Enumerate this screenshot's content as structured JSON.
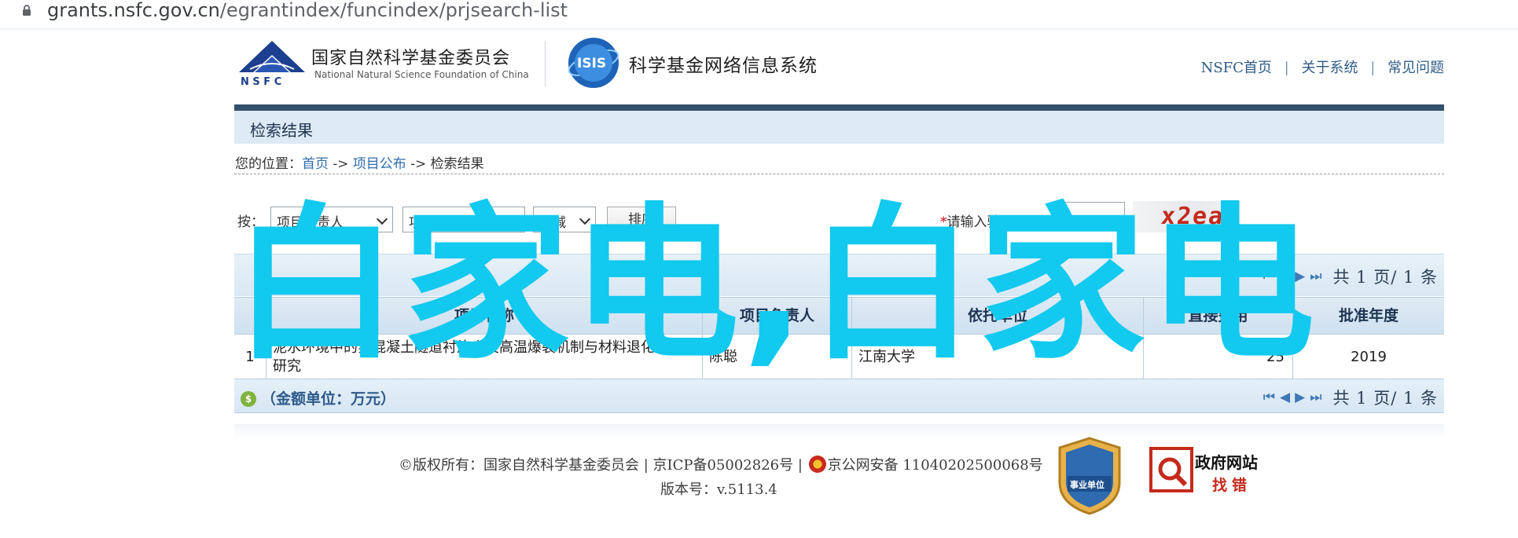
{
  "browser": {
    "url_domain": "grants.nsfc.gov.cn",
    "url_path": "/egrantindex/funcindex/prjsearch-list"
  },
  "header": {
    "org_name_cn": "国家自然科学基金委员会",
    "org_name_en": "National Natural Science Foundation of China",
    "logo_text": "N S F C",
    "isis_logo_text": "ISIS",
    "system_title": "科学基金网络信息系统",
    "links": [
      "NSFC首页",
      "关于系统",
      "常见问题"
    ],
    "link_separator": "|"
  },
  "section": {
    "title": "检索结果"
  },
  "breadcrumb": {
    "prefix": "您的位置：",
    "items": [
      "首页",
      "项目公布",
      "检索结果"
    ],
    "separator": " -> "
  },
  "sort": {
    "label": "按：",
    "select1": "项目负责人",
    "select2": "项目名称",
    "select3": "递减",
    "button": "排序",
    "captcha_required_mark": "*",
    "captcha_label": "请输入验证码：",
    "captcha_input_value": "",
    "captcha_image_text": "x2ea"
  },
  "pager": {
    "text": "共 1 页/ 1 条"
  },
  "table": {
    "columns": [
      "",
      "项目名称",
      "项目负责人",
      "依托单位",
      "直接费用",
      "批准年度"
    ],
    "rows": [
      {
        "index": "1",
        "name": "泥水环境中的实混凝土隧道衬片火灾高温爆裂机制与材料退化规律研究",
        "leader": "陈聪",
        "institution": "江南大学",
        "cost": "25",
        "year": "2019"
      }
    ],
    "unit_note": "（金额单位：万元）"
  },
  "overlay": {
    "text": "白家电,白家电"
  },
  "footer": {
    "copyright": "©版权所有：国家自然科学基金委员会 | 京ICP备05002826号 | ",
    "police_record": "京公网安备 11040202500068号",
    "version_label": "版本号：",
    "version_value": "v.5113.4",
    "badge_institution": "事业单位",
    "badge_gov_title": "政府网站",
    "badge_gov_sub": "找错"
  },
  "colors": {
    "accent_blue": "#2f6dae",
    "header_bar": "#344f6c",
    "overlay": "#12c9ef",
    "captcha_text": "#c42a1c"
  }
}
